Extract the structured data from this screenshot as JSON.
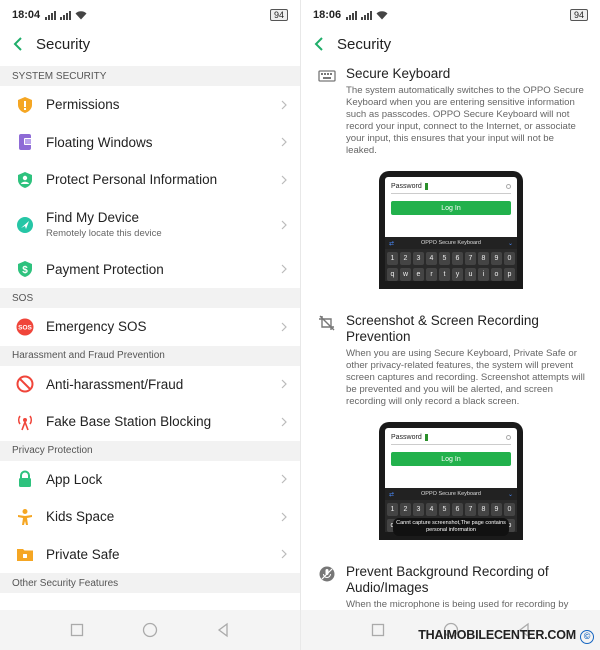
{
  "left": {
    "status": {
      "time": "18:04",
      "battery": "94"
    },
    "title": "Security",
    "sections": [
      {
        "header": "SYSTEM SECURITY",
        "items": [
          {
            "label": "Permissions",
            "icon": "shield-icon",
            "color": "#f5a623"
          },
          {
            "label": "Floating Windows",
            "icon": "floating-window-icon",
            "color": "#8e6bd6"
          },
          {
            "label": "Protect Personal Information",
            "icon": "person-shield-icon",
            "color": "#2ec27e"
          },
          {
            "label": "Find My Device",
            "sub": "Remotely locate this device",
            "icon": "locate-icon",
            "color": "#26c6a6"
          },
          {
            "label": "Payment Protection",
            "icon": "dollar-shield-icon",
            "color": "#2ec27e"
          }
        ]
      },
      {
        "header": "SOS",
        "items": [
          {
            "label": "Emergency SOS",
            "icon": "sos-icon",
            "color": "#f0453a"
          }
        ]
      },
      {
        "header": "Harassment and Fraud Prevention",
        "items": [
          {
            "label": "Anti-harassment/Fraud",
            "icon": "block-icon",
            "color": "#f0453a"
          },
          {
            "label": "Fake Base Station Blocking",
            "icon": "signal-tower-icon",
            "color": "#f0453a"
          }
        ]
      },
      {
        "header": "Privacy Protection",
        "items": [
          {
            "label": "App Lock",
            "icon": "lock-icon",
            "color": "#2ec27e"
          },
          {
            "label": "Kids Space",
            "icon": "kid-icon",
            "color": "#f5a623"
          },
          {
            "label": "Private Safe",
            "icon": "safe-folder-icon",
            "color": "#f5a623"
          }
        ]
      },
      {
        "header": "Other Security Features",
        "items": []
      }
    ]
  },
  "right": {
    "status": {
      "time": "18:06",
      "battery": "94"
    },
    "title": "Security",
    "features": [
      {
        "title": "Secure Keyboard",
        "desc": "The system automatically switches to the OPPO Secure Keyboard when you are entering sensitive information such as passcodes. OPPO Secure Keyboard will not record your input, connect to the Internet, or associate your input, this ensures that your input will not be leaked."
      },
      {
        "title": "Screenshot & Screen Recording Prevention",
        "desc": "When you are using Secure Keyboard, Private Safe or other privacy-related features, the system will prevent screen captures and recording. Screenshot attempts will be prevented and you will be alerted, and screen recording will only record a black screen."
      },
      {
        "title": "Prevent Background Recording of Audio/Images",
        "desc": "When the microphone is being used for recording by"
      }
    ],
    "phone": {
      "password_label": "Password",
      "login_label": "Log In",
      "keyboard_title": "OPPO Secure Keyboard",
      "digits": [
        "1",
        "2",
        "3",
        "4",
        "5",
        "6",
        "7",
        "8",
        "9",
        "0"
      ],
      "letters": [
        "q",
        "w",
        "e",
        "r",
        "t",
        "y",
        "u",
        "i",
        "o",
        "p"
      ],
      "toast": "Cannt capture screenshot,The page contains personal information"
    }
  },
  "watermark": {
    "text": "THAIMOBILECENTER.COM",
    "symbol": "©"
  }
}
